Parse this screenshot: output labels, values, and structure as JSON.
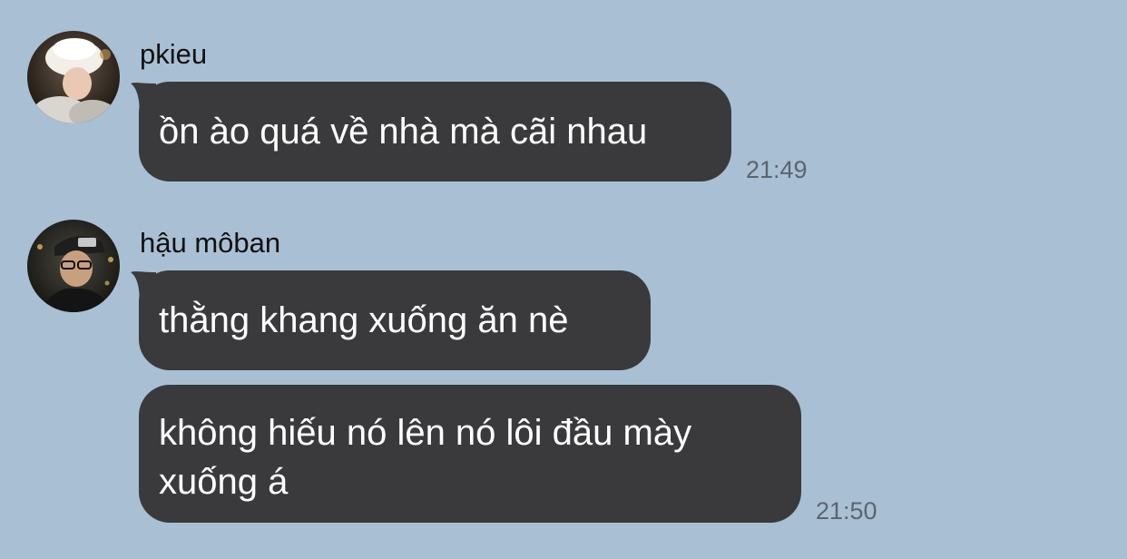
{
  "messages": [
    {
      "sender": "pkieu",
      "avatar": "user-avatar-pkieu",
      "bubbles": [
        {
          "lines": [
            "ồn ào quá về nhà mà cãi nhau"
          ]
        }
      ],
      "time": "21:49"
    },
    {
      "sender": "hậu môban",
      "avatar": "user-avatar-hau-moban",
      "bubbles": [
        {
          "lines": [
            "thằng khang xuống ăn nè"
          ]
        },
        {
          "lines": [
            "không hiếu nó lên nó lôi đầu mày",
            "xuống á"
          ]
        }
      ],
      "time": "21:50"
    }
  ],
  "colors": {
    "background": "#a9bfd3",
    "bubble": "#3a3a3c",
    "bubble_text": "#ffffff",
    "sender_text": "#111111",
    "time_text": "#5b6570"
  }
}
